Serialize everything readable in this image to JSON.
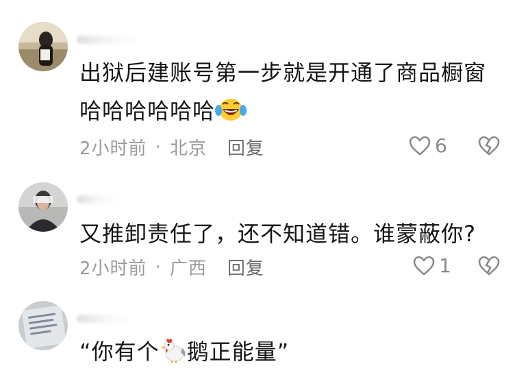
{
  "comments": [
    {
      "text_line1": "出狱后建账号第一步就是开通了商品橱窗",
      "text_line2": "哈哈哈哈哈哈",
      "emoji": "laughing-tears-emoji",
      "time": "2小时前",
      "separator": "·",
      "location": "北京",
      "reply_label": "回复",
      "like_count": "6"
    },
    {
      "text": "又推卸责任了，还不知道错。谁蒙蔽你?",
      "time": "2小时前",
      "separator": "·",
      "location": "广西",
      "reply_label": "回复",
      "like_count": "1"
    },
    {
      "text_before": "“你有个",
      "emoji": "rooster-emoji",
      "text_after": "鹅正能量”"
    }
  ],
  "icons": {
    "like": "heart-outline-icon",
    "dislike": "broken-heart-outline-icon"
  },
  "colors": {
    "text": "#161616",
    "meta": "#9a9a9a",
    "icon": "#8a8a8a"
  }
}
